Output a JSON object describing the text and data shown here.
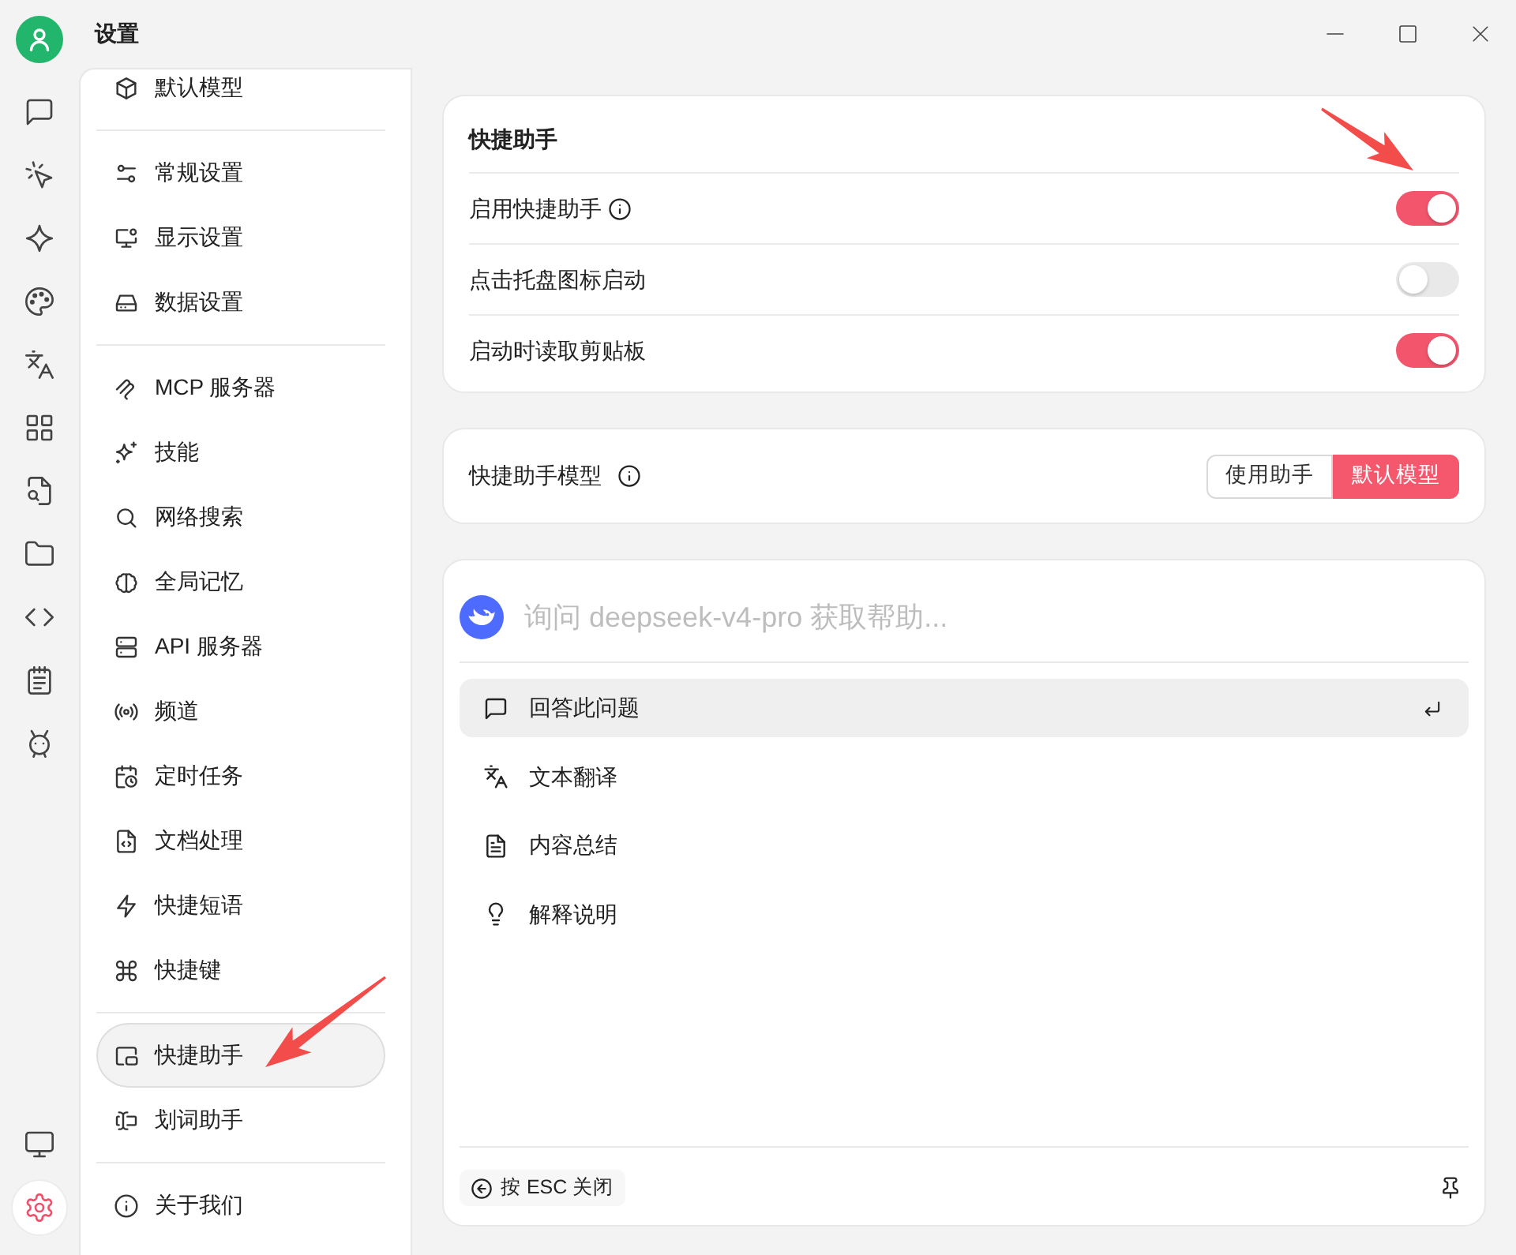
{
  "window": {
    "title": "设置"
  },
  "rail": {
    "items": [
      {
        "selected": false
      },
      {
        "selected": false
      },
      {
        "selected": false
      },
      {
        "selected": false
      },
      {
        "selected": false
      },
      {
        "selected": false
      },
      {
        "selected": false
      },
      {
        "selected": false
      },
      {
        "selected": false
      },
      {
        "selected": false
      },
      {
        "selected": false
      }
    ],
    "bottom": [
      {
        "selected": false
      },
      {
        "selected": true
      }
    ]
  },
  "sidebar": {
    "groups": [
      [
        {
          "label": "默认模型",
          "selected": false
        }
      ],
      [
        {
          "label": "常规设置",
          "selected": false
        },
        {
          "label": "显示设置",
          "selected": false
        },
        {
          "label": "数据设置",
          "selected": false
        }
      ],
      [
        {
          "label": "MCP 服务器",
          "selected": false
        },
        {
          "label": "技能",
          "selected": false
        },
        {
          "label": "网络搜索",
          "selected": false
        },
        {
          "label": "全局记忆",
          "selected": false
        },
        {
          "label": "API 服务器",
          "selected": false
        },
        {
          "label": "频道",
          "selected": false
        },
        {
          "label": "定时任务",
          "selected": false
        },
        {
          "label": "文档处理",
          "selected": false
        },
        {
          "label": "快捷短语",
          "selected": false
        },
        {
          "label": "快捷键",
          "selected": false
        }
      ],
      [
        {
          "label": "快捷助手",
          "selected": true
        },
        {
          "label": "划词助手",
          "selected": false
        }
      ],
      [
        {
          "label": "关于我们",
          "selected": false
        }
      ]
    ]
  },
  "assistant_settings": {
    "title": "快捷助手",
    "rows": [
      {
        "label": "启用快捷助手",
        "info": true,
        "on": true
      },
      {
        "label": "点击托盘图标启动",
        "info": false,
        "on": false
      },
      {
        "label": "启动时读取剪贴板",
        "info": false,
        "on": true
      }
    ]
  },
  "model_setting": {
    "label": "快捷助手模型",
    "info": true,
    "options": [
      {
        "label": "使用助手",
        "selected": false
      },
      {
        "label": "默认模型",
        "selected": true
      }
    ]
  },
  "preview": {
    "input": {
      "placeholder": "询问 deepseek-v4-pro 获取帮助..."
    },
    "actions": [
      {
        "label": "回答此问题",
        "selected": true
      },
      {
        "label": "文本翻译",
        "selected": false
      },
      {
        "label": "内容总结",
        "selected": false
      },
      {
        "label": "解释说明",
        "selected": false
      }
    ],
    "close_hint": "按 ESC 关闭"
  }
}
